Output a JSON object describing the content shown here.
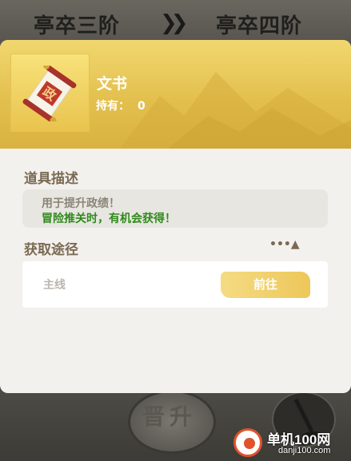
{
  "background": {
    "rank_from": "亭卒三阶",
    "rank_to": "亭卒四阶",
    "promote_label": "晋升"
  },
  "modal": {
    "item": {
      "name": "文书",
      "hold_label": "持有：",
      "hold_count": "0",
      "icon": "scroll-icon"
    },
    "description": {
      "title": "道具描述",
      "line1": "用于提升政绩！",
      "line2": "冒险推关时，有机会获得！"
    },
    "sources": {
      "title": "获取途径",
      "more_label": "•••▲",
      "items": [
        {
          "name": "主线",
          "action": "前往"
        }
      ]
    }
  },
  "watermark": {
    "text": "单机100网",
    "url": "danji100.com"
  },
  "colors": {
    "header_gold": "#e3c04e",
    "accent_green": "#2f8a1c",
    "title_brown": "#7b6a53"
  }
}
